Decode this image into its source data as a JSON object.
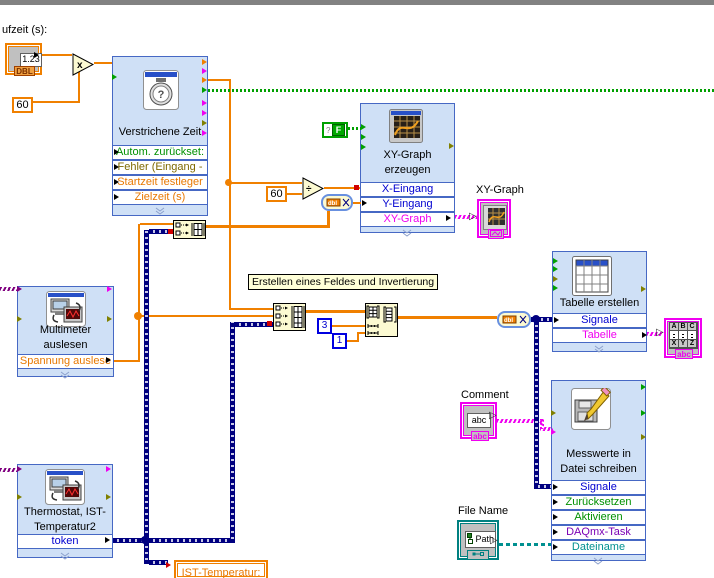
{
  "diagram": {
    "runtime_label": "ufzeit (s):",
    "array_note": "Erstellen eines Feldes und Invertierung"
  },
  "controls": {
    "runtime": {
      "value": "1.23",
      "tab": "DBL"
    },
    "bool_const": "F",
    "const_60_timer": "60",
    "const_60_divider": "60",
    "const_rows": "3",
    "const_cols": "1",
    "comment": {
      "label": "Comment",
      "value": "abc",
      "tab": "abc"
    },
    "file_name": {
      "label": "File Name",
      "value": "Path"
    }
  },
  "indicators": {
    "xy_graph_label": "XY-Graph",
    "ist_temp": "IST-Temperatur:",
    "table": {
      "header": [
        "A",
        "B",
        "C"
      ],
      "footer": [
        "X",
        "Y",
        "Z"
      ],
      "tab": "abc"
    }
  },
  "operators": {
    "multiply": "x",
    "divide": "÷",
    "convert": "dbl"
  },
  "vis": {
    "elapsed": {
      "title": "Verstrichene Zeit",
      "rows": [
        "Autom. zurückset:",
        "Fehler (Eingang -",
        "Startzeit festleger",
        "Zielzeit (s)"
      ]
    },
    "xy": {
      "title1": "XY-Graph",
      "title2": "erzeugen",
      "rows": [
        "X-Eingang",
        "Y-Eingang",
        "XY-Graph"
      ]
    },
    "table": {
      "title": "Tabelle erstellen",
      "rows": [
        "Signale",
        "Tabelle"
      ]
    },
    "write": {
      "title1": "Messwerte in",
      "title2": "Datei schreiben",
      "rows": [
        "Signale",
        "Zurücksetzen",
        "Aktivieren",
        "DAQmx-Task",
        "Dateiname"
      ]
    },
    "multimeter": {
      "title1": "Multimeter",
      "title2": "auslesen",
      "rows": [
        "Spannung auslese"
      ]
    },
    "thermostat": {
      "title1": "Thermostat, IST-",
      "title2": "Temperatur2",
      "rows": [
        "token"
      ]
    }
  },
  "colors": {
    "wire_orange": "#F08000",
    "wire_dynamic": "#000080",
    "wire_boolean": "#00A000",
    "wire_string": "#F000F0",
    "wire_visa": "#800080",
    "wire_path": "#008080",
    "vi_fill": "#CFE0F6",
    "vi_border": "#4668C4"
  }
}
